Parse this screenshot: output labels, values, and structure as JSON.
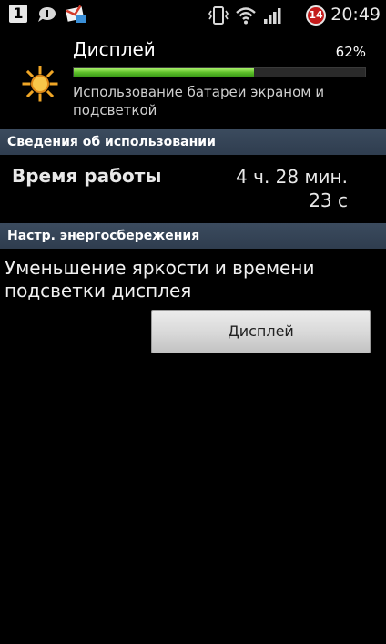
{
  "status_bar": {
    "badge_number": "1",
    "notification_count": "14",
    "time": "20:49",
    "icons": [
      "sim-1-badge",
      "chat-icon",
      "gmail-icon",
      "vibrate-icon",
      "wifi-icon",
      "signal-icon",
      "notification-badge"
    ]
  },
  "app": {
    "title": "Дисплей",
    "percent_label": "62%",
    "percent_value": 0.62,
    "description": "Использование батареи экраном и подсветкой",
    "icon": "sun-icon",
    "progress_color": "#5ec02a"
  },
  "usage": {
    "section_title": "Сведения об использовании",
    "label": "Время работы",
    "value_line1": "4 ч. 28 мин.",
    "value_line2": "23 с"
  },
  "power_saving": {
    "section_title": "Настр. энергосбережения",
    "description": "Уменьшение яркости и времени подсветки дисплея",
    "button_label": "Дисплей"
  },
  "colors": {
    "background": "#000000",
    "section_header": "#34455a",
    "notification_badge": "#c41a1a"
  }
}
